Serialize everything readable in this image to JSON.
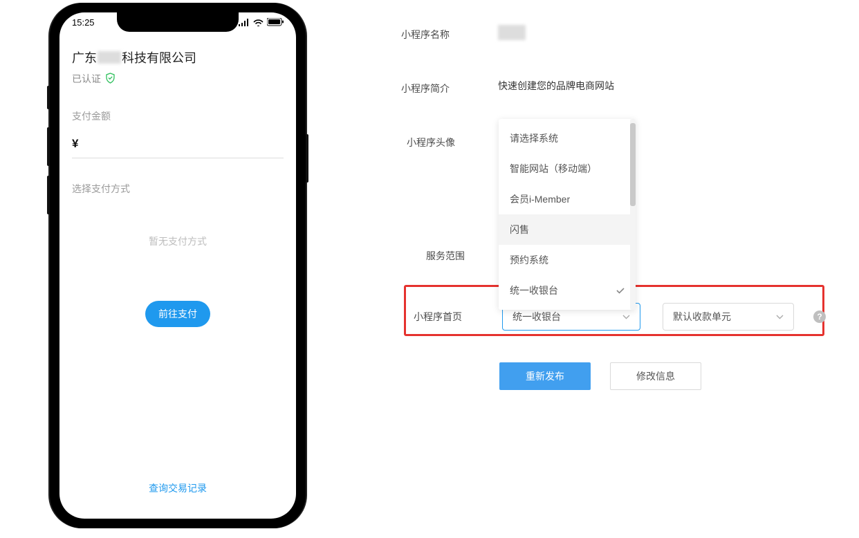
{
  "phone": {
    "time": "15:25",
    "company_prefix": "广东",
    "company_suffix": "科技有限公司",
    "verified_text": "已认证",
    "amount_label": "支付金额",
    "currency": "¥",
    "payment_method_label": "选择支付方式",
    "no_payment_text": "暂无支付方式",
    "pay_button": "前往支付",
    "query_link": "查询交易记录"
  },
  "form": {
    "name_label": "小程序名称",
    "intro_label": "小程序简介",
    "intro_value": "快速创建您的品牌电商网站",
    "avatar_label": "小程序头像",
    "scope_label": "服务范围",
    "homepage_label": "小程序首页",
    "select1_value": "统一收银台",
    "select2_value": "默认收款单元",
    "republish_button": "重新发布",
    "modify_button": "修改信息"
  },
  "dropdown": {
    "items": [
      {
        "label": "请选择系统",
        "hovered": false,
        "checked": false
      },
      {
        "label": "智能网站（移动端）",
        "hovered": false,
        "checked": false
      },
      {
        "label": "会员i-Member",
        "hovered": false,
        "checked": false
      },
      {
        "label": "闪售",
        "hovered": true,
        "checked": false
      },
      {
        "label": "预约系统",
        "hovered": false,
        "checked": false
      },
      {
        "label": "统一收银台",
        "hovered": false,
        "checked": true
      }
    ]
  }
}
